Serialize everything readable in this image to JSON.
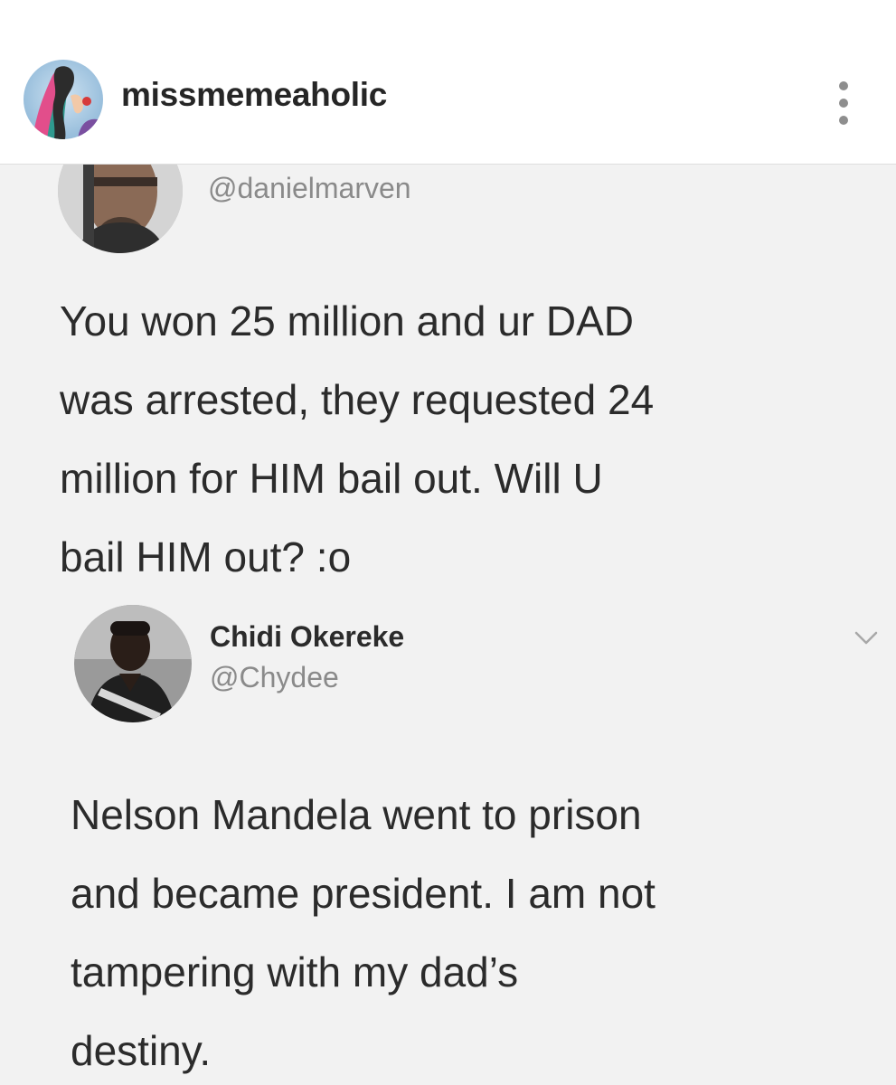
{
  "post": {
    "username": "missmemeaholic",
    "more_icon": "more-vertical-icon"
  },
  "tweet_main": {
    "handle": "@danielmarven",
    "text": "You won 25 million and ur DAD\nwas arrested, they requested 24\nmillion for HIM bail out. Will U\nbail HIM out? :o"
  },
  "tweet_reply": {
    "name": "Chidi Okereke",
    "handle": "@Chydee",
    "dropdown_icon": "chevron-down-icon",
    "text": "Nelson Mandela went to prison\nand became president. I am not\ntampering with my dad’s\ndestiny."
  },
  "colors": {
    "header_bg": "#ffffff",
    "content_bg": "#f2f2f2",
    "text": "#2b2b2b",
    "muted": "#8a8a8a"
  }
}
